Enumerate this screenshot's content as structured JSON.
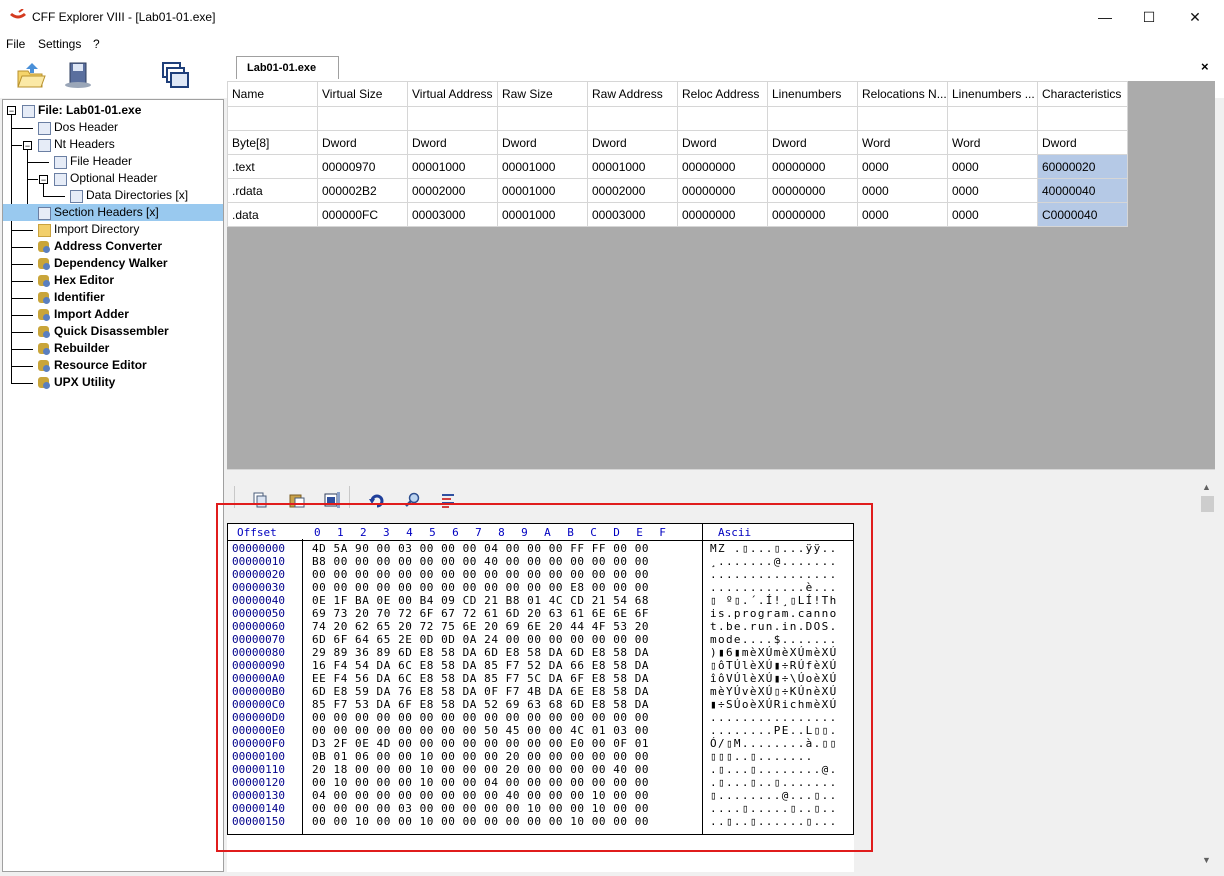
{
  "window": {
    "title": "CFF Explorer VIII - [Lab01-01.exe]",
    "minimize": "—",
    "maximize": "☐",
    "close": "✕"
  },
  "menu": [
    "File",
    "Settings",
    "?"
  ],
  "tab": {
    "label": "Lab01-01.exe",
    "close": "×"
  },
  "tree": {
    "root": "File: Lab01-01.exe",
    "items": [
      {
        "label": "Dos Header"
      },
      {
        "label": "Nt Headers"
      },
      {
        "label": "File Header"
      },
      {
        "label": "Optional Header"
      },
      {
        "label": "Data Directories [x]"
      },
      {
        "label": "Section Headers [x]"
      },
      {
        "label": "Import Directory"
      },
      {
        "label": "Address Converter"
      },
      {
        "label": "Dependency Walker"
      },
      {
        "label": "Hex Editor"
      },
      {
        "label": "Identifier"
      },
      {
        "label": "Import Adder"
      },
      {
        "label": "Quick Disassembler"
      },
      {
        "label": "Rebuilder"
      },
      {
        "label": "Resource Editor"
      },
      {
        "label": "UPX Utility"
      }
    ]
  },
  "sections": {
    "columns": [
      "Name",
      "Virtual Size",
      "Virtual Address",
      "Raw Size",
      "Raw Address",
      "Reloc Address",
      "Linenumbers",
      "Relocations N...",
      "Linenumbers ...",
      "Characteristics"
    ],
    "types": [
      "Byte[8]",
      "Dword",
      "Dword",
      "Dword",
      "Dword",
      "Dword",
      "Dword",
      "Word",
      "Word",
      "Dword"
    ],
    "rows": [
      [
        ".text",
        "00000970",
        "00001000",
        "00001000",
        "00001000",
        "00000000",
        "00000000",
        "0000",
        "0000",
        "60000020"
      ],
      [
        ".rdata",
        "000002B2",
        "00002000",
        "00001000",
        "00002000",
        "00000000",
        "00000000",
        "0000",
        "0000",
        "40000040"
      ],
      [
        ".data",
        "000000FC",
        "00003000",
        "00001000",
        "00003000",
        "00000000",
        "00000000",
        "0000",
        "0000",
        "C0000040"
      ]
    ]
  },
  "hex": {
    "offset_header": "Offset",
    "byte_header": "0  1  2  3  4  5  6  7  8  9  A  B  C  D  E  F",
    "ascii_header": "Ascii",
    "rows": [
      {
        "off": "00000000",
        "bytes": "4D 5A 90 00 03 00 00 00 04 00 00 00 FF FF 00 00",
        "ascii": "MZ .▯...▯...ÿÿ.."
      },
      {
        "off": "00000010",
        "bytes": "B8 00 00 00 00 00 00 00 40 00 00 00 00 00 00 00",
        "ascii": "¸.......@......."
      },
      {
        "off": "00000020",
        "bytes": "00 00 00 00 00 00 00 00 00 00 00 00 00 00 00 00",
        "ascii": "................"
      },
      {
        "off": "00000030",
        "bytes": "00 00 00 00 00 00 00 00 00 00 00 00 E8 00 00 00",
        "ascii": "............è..."
      },
      {
        "off": "00000040",
        "bytes": "0E 1F BA 0E 00 B4 09 CD 21 B8 01 4C CD 21 54 68",
        "ascii": "▯ º▯.´.Í!¸▯LÍ!Th"
      },
      {
        "off": "00000050",
        "bytes": "69 73 20 70 72 6F 67 72 61 6D 20 63 61 6E 6E 6F",
        "ascii": "is.program.canno"
      },
      {
        "off": "00000060",
        "bytes": "74 20 62 65 20 72 75 6E 20 69 6E 20 44 4F 53 20",
        "ascii": "t.be.run.in.DOS."
      },
      {
        "off": "00000070",
        "bytes": "6D 6F 64 65 2E 0D 0D 0A 24 00 00 00 00 00 00 00",
        "ascii": "mode....$......."
      },
      {
        "off": "00000080",
        "bytes": "29 89 36 89 6D E8 58 DA 6D E8 58 DA 6D E8 58 DA",
        "ascii": ")▮6▮mèXÚmèXÚmèXÚ"
      },
      {
        "off": "00000090",
        "bytes": "16 F4 54 DA 6C E8 58 DA 85 F7 52 DA 66 E8 58 DA",
        "ascii": "▯ôTÚlèXÚ▮÷RÚfèXÚ"
      },
      {
        "off": "000000A0",
        "bytes": "EE F4 56 DA 6C E8 58 DA 85 F7 5C DA 6F E8 58 DA",
        "ascii": "îôVÚlèXÚ▮÷\\ÚoèXÚ"
      },
      {
        "off": "000000B0",
        "bytes": "6D E8 59 DA 76 E8 58 DA 0F F7 4B DA 6E E8 58 DA",
        "ascii": "mèYÚvèXÚ▯÷KÚnèXÚ"
      },
      {
        "off": "000000C0",
        "bytes": "85 F7 53 DA 6F E8 58 DA 52 69 63 68 6D E8 58 DA",
        "ascii": "▮÷SÚoèXÚRichmèXÚ"
      },
      {
        "off": "000000D0",
        "bytes": "00 00 00 00 00 00 00 00 00 00 00 00 00 00 00 00",
        "ascii": "................"
      },
      {
        "off": "000000E0",
        "bytes": "00 00 00 00 00 00 00 00 50 45 00 00 4C 01 03 00",
        "ascii": "........PE..L▯▯."
      },
      {
        "off": "000000F0",
        "bytes": "D3 2F 0E 4D 00 00 00 00 00 00 00 00 E0 00 0F 01",
        "ascii": "Ó/▯M........à.▯▯"
      },
      {
        "off": "00000100",
        "bytes": "0B 01 06 00 00 10 00 00 00 20 00 00 00 00 00 00",
        "ascii": "▯▯▯..▯......."
      },
      {
        "off": "00000110",
        "bytes": "20 18 00 00 00 10 00 00 00 20 00 00 00 00 40 00",
        "ascii": ".▯...▯........@."
      },
      {
        "off": "00000120",
        "bytes": "00 10 00 00 00 10 00 00 04 00 00 00 00 00 00 00",
        "ascii": ".▯...▯..▯......."
      },
      {
        "off": "00000130",
        "bytes": "04 00 00 00 00 00 00 00 00 40 00 00 00 10 00 00",
        "ascii": "▯........@...▯.."
      },
      {
        "off": "00000140",
        "bytes": "00 00 00 00 03 00 00 00 00 00 10 00 00 10 00 00",
        "ascii": "....▯.....▯..▯.."
      },
      {
        "off": "00000150",
        "bytes": "00 00 10 00 00 10 00 00 00 00 00 00 10 00 00 00",
        "ascii": "..▯..▯......▯..."
      }
    ]
  },
  "colors": {
    "selection": "#99c9ef",
    "characteristics_cell": "#b5c9e6",
    "grid_background": "#ababab",
    "annotation_box": "#e01c1c",
    "offset_text": "#00008b"
  }
}
